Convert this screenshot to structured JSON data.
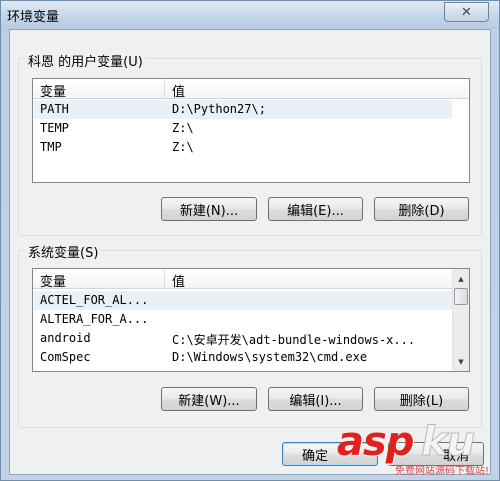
{
  "window": {
    "title": "环境变量",
    "close_glyph": "✕"
  },
  "user_vars": {
    "label": "科恩 的用户变量(U)",
    "headers": {
      "name": "变量",
      "value": "值"
    },
    "rows": [
      {
        "name": "PATH",
        "value": "D:\\Python27\\;"
      },
      {
        "name": "TEMP",
        "value": "Z:\\"
      },
      {
        "name": "TMP",
        "value": "Z:\\"
      }
    ],
    "buttons": {
      "new": "新建(N)...",
      "edit": "编辑(E)...",
      "delete": "删除(D)"
    }
  },
  "system_vars": {
    "label": "系统变量(S)",
    "headers": {
      "name": "变量",
      "value": "值"
    },
    "rows": [
      {
        "name": "ACTEL_FOR_AL...",
        "value": ""
      },
      {
        "name": "ALTERA_FOR_A...",
        "value": ""
      },
      {
        "name": "android",
        "value": "C:\\安卓开发\\adt-bundle-windows-x..."
      },
      {
        "name": "ComSpec",
        "value": "D:\\Windows\\system32\\cmd.exe"
      }
    ],
    "buttons": {
      "new": "新建(W)...",
      "edit": "编辑(I)...",
      "delete": "删除(L)"
    }
  },
  "footer": {
    "ok": "确定",
    "cancel": "取消"
  },
  "watermark": {
    "brand_red": "asp",
    "brand_white": "ku",
    "tagline": "免费网站源码下载站!"
  }
}
